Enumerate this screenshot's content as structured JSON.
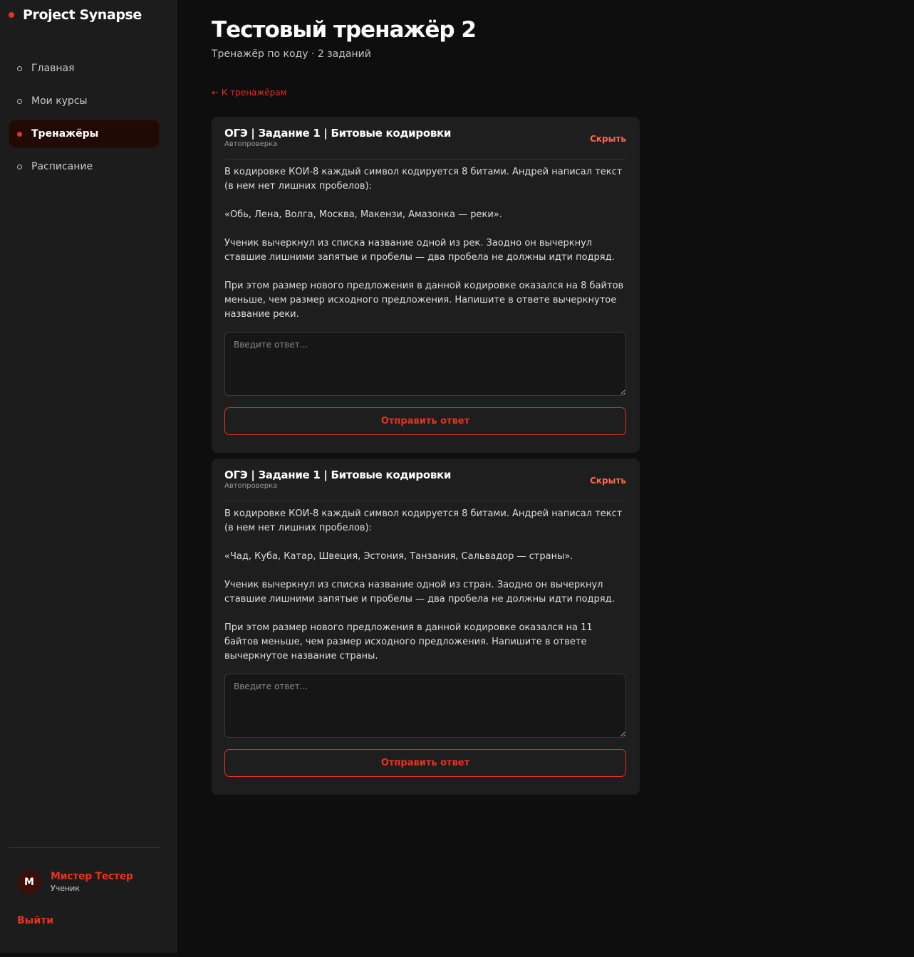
{
  "brand": {
    "name": "Project Synapse"
  },
  "nav": {
    "items": [
      {
        "label": "Главная",
        "active": false
      },
      {
        "label": "Мои курсы",
        "active": false
      },
      {
        "label": "Тренажёры",
        "active": true
      },
      {
        "label": "Расписание",
        "active": false
      }
    ]
  },
  "user": {
    "initial": "М",
    "name": "Мистер Тестер",
    "role": "Ученик"
  },
  "logout_label": "Выйти",
  "page": {
    "title": "Тестовый тренажёр 2",
    "subtitle": "Тренажёр по коду · 2 заданий",
    "back_link": "← К тренажёрам"
  },
  "tasks": [
    {
      "title": "ОГЭ | Задание 1 | Битовые кодировки",
      "tag": "Автопроверка",
      "hide_label": "Скрыть",
      "paragraphs": [
        "В кодировке КОИ-8 каждый символ кодируется 8 битами. Андрей написал текст (в нем нет лишних пробелов):",
        "«Обь, Лена, Волга, Москва, Макензи, Амазонка — реки».",
        "Ученик вычеркнул из списка название одной из рек. Заодно он вычеркнул ставшие лишними запятые и пробелы — два пробела не должны идти подряд.",
        "При этом размер нового предложения в данной кодировке оказался на 8 байтов меньше, чем размер исходного предложения. Напишите в ответе вычеркнутое название реки."
      ],
      "answer_placeholder": "Введите ответ...",
      "submit_label": "Отправить ответ"
    },
    {
      "title": "ОГЭ | Задание 1 | Битовые кодировки",
      "tag": "Автопроверка",
      "hide_label": "Скрыть",
      "paragraphs": [
        "В кодировке КОИ-8 каждый символ кодируется 8 битами. Андрей написал текст (в нем нет лишних пробелов):",
        "«Чад, Куба, Катар, Швеция, Эстония, Танзания, Сальвадор — страны».",
        "Ученик вычеркнул из списка название одной из стран. Заодно он вычеркнул ставшие лишними запятые и пробелы — два пробела не должны идти подряд.",
        "При этом размер нового предложения в данной кодировке оказался на 11 байтов меньше, чем размер исходного предложения. Напишите в ответе вычеркнутое название страны."
      ],
      "answer_placeholder": "Введите ответ...",
      "submit_label": "Отправить ответ"
    }
  ]
}
